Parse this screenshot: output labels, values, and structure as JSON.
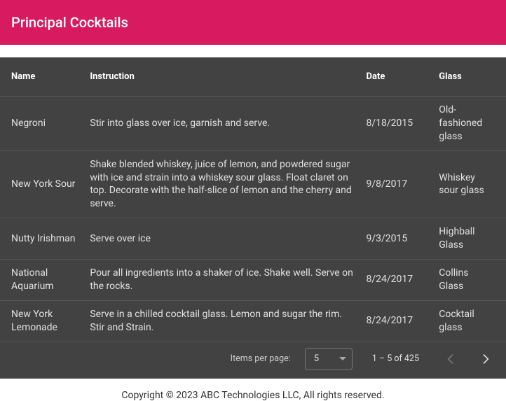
{
  "header": {
    "title": "Principal Cocktails"
  },
  "columns": {
    "name": "Name",
    "instruction": "Instruction",
    "date": "Date",
    "glass": "Glass"
  },
  "rows": [
    {
      "name": "Negroni",
      "instruction": "Stir into glass over ice, garnish and serve.",
      "date": "8/18/2015",
      "glass": "Old-fashioned glass"
    },
    {
      "name": "New York Sour",
      "instruction": "Shake blended whiskey, juice of lemon, and powdered sugar with ice and strain into a whiskey sour glass. Float claret on top. Decorate with the half-slice of lemon and the cherry and serve.",
      "date": "9/8/2017",
      "glass": "Whiskey sour glass"
    },
    {
      "name": "Nutty Irishman",
      "instruction": "Serve over ice",
      "date": "9/3/2015",
      "glass": "Highball Glass"
    },
    {
      "name": "National Aquarium",
      "instruction": "Pour all ingredients into a shaker of ice. Shake well. Serve on the rocks.",
      "date": "8/24/2017",
      "glass": "Collins Glass"
    },
    {
      "name": "New York Lemonade",
      "instruction": "Serve in a chilled cocktail glass. Lemon and sugar the rim. Stir and Strain.",
      "date": "8/24/2017",
      "glass": "Cocktail glass"
    }
  ],
  "paginator": {
    "items_per_page_label": "Items per page:",
    "page_size": "5",
    "range_label": "1 – 5 of 425",
    "prev_disabled": true,
    "next_disabled": false
  },
  "footer": "Copyright © 2023 ABC Technologies LLC, All rights reserved."
}
